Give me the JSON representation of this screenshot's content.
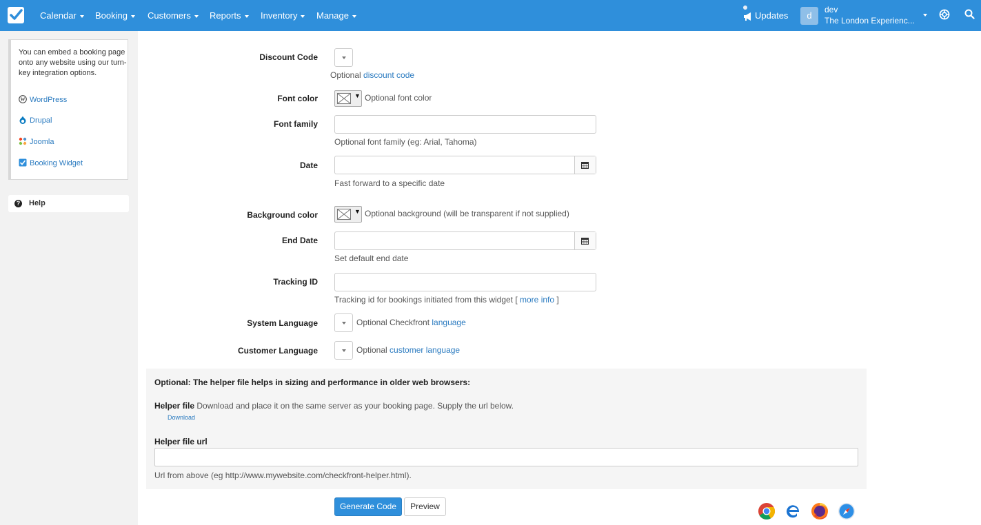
{
  "nav": {
    "items": [
      {
        "label": "Calendar"
      },
      {
        "label": "Booking"
      },
      {
        "label": "Customers"
      },
      {
        "label": "Reports"
      },
      {
        "label": "Inventory"
      },
      {
        "label": "Manage"
      }
    ],
    "updates_label": "Updates",
    "user": {
      "avatar_letter": "d",
      "name": "dev",
      "org": "The London Experienc..."
    },
    "brand_color": "#2f8fdb"
  },
  "sidebar": {
    "embed_text": "You can embed a booking page onto any website using our turn-key integration options.",
    "links": [
      {
        "label": "WordPress",
        "icon": "wordpress-icon"
      },
      {
        "label": "Drupal",
        "icon": "drupal-icon"
      },
      {
        "label": "Joomla",
        "icon": "joomla-icon"
      },
      {
        "label": "Booking Widget",
        "icon": "checkmark-icon"
      }
    ],
    "help_label": "Help"
  },
  "form": {
    "discount_code": {
      "label": "Discount Code",
      "hint_prefix": "Optional ",
      "hint_link": "discount code"
    },
    "font_color": {
      "label": "Font color",
      "hint": "Optional font color"
    },
    "font_family": {
      "label": "Font family",
      "value": "",
      "hint": "Optional font family (eg: Arial, Tahoma)"
    },
    "date": {
      "label": "Date",
      "value": "",
      "hint": "Fast forward to a specific date"
    },
    "background_color": {
      "label": "Background color",
      "hint": "Optional background (will be transparent if not supplied)"
    },
    "end_date": {
      "label": "End Date",
      "value": "",
      "hint": "Set default end date"
    },
    "tracking_id": {
      "label": "Tracking ID",
      "value": "",
      "hint_prefix": "Tracking id for bookings initiated from this widget [ ",
      "hint_link": "more info",
      "hint_suffix": " ]"
    },
    "system_language": {
      "label": "System Language",
      "hint_prefix": "Optional Checkfront ",
      "hint_link": "language"
    },
    "customer_language": {
      "label": "Customer Language",
      "hint_prefix": "Optional ",
      "hint_link": "customer language"
    }
  },
  "helper": {
    "title": "Optional: The helper file helps in sizing and performance in older web browsers:",
    "file_label": "Helper file",
    "file_text": " Download and place it on the same server as your booking page. Supply the url below.",
    "download_label": "Download",
    "url_label": "Helper file url",
    "url_value": "",
    "url_hint": "Url from above (eg http://www.mywebsite.com/checkfront-helper.html)."
  },
  "actions": {
    "generate_label": "Generate Code",
    "preview_label": "Preview"
  },
  "browsers": [
    "chrome-icon",
    "edge-icon",
    "firefox-icon",
    "safari-icon"
  ]
}
